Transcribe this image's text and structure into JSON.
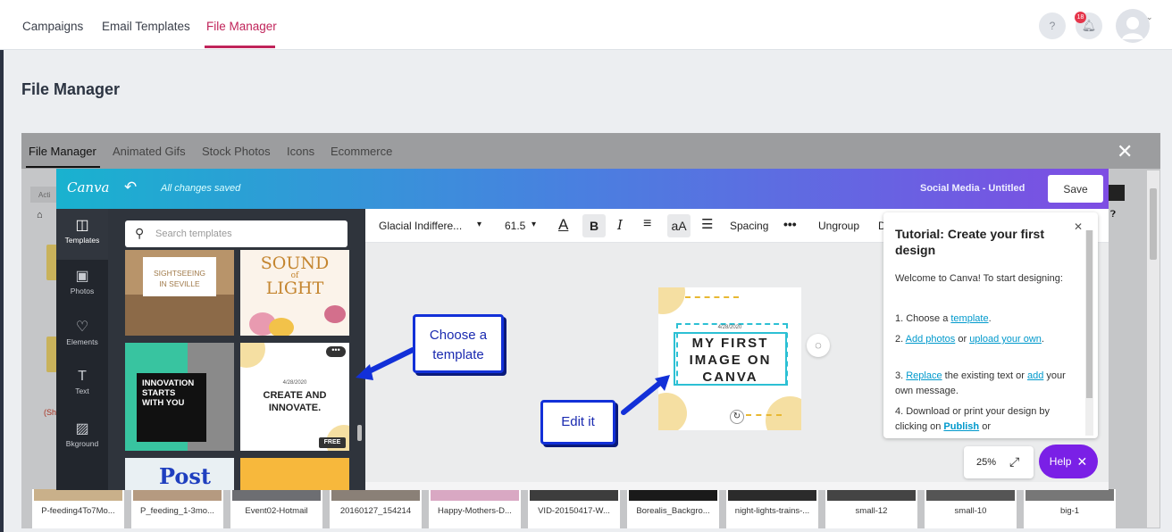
{
  "topnav": {
    "tabs": [
      "Campaigns",
      "Email Templates",
      "File Manager"
    ],
    "active": "File Manager",
    "help_glyph": "?",
    "notif_count": "18"
  },
  "page": {
    "title": "File Manager"
  },
  "modal": {
    "tabs": [
      "File Manager",
      "Animated Gifs",
      "Stock Photos",
      "Icons",
      "Ecommerce"
    ],
    "behind_label": "(Sh",
    "thumbnails": [
      "P-feeding4To7Mo...",
      "P_feeding_1-3mo...",
      "Event02-Hotmail",
      "20160127_154214",
      "Happy-Mothers-D...",
      "VID-20150417-W...",
      "Borealis_Backgro...",
      "night-lights-trains-...",
      "small-12",
      "small-10",
      "big-1"
    ]
  },
  "canva": {
    "logo": "Canva",
    "saved_status": "All changes saved",
    "doc_title": "Social Media - Untitled",
    "save_label": "Save",
    "rail": [
      {
        "label": "Templates",
        "icon": "templates-icon"
      },
      {
        "label": "Photos",
        "icon": "photos-icon"
      },
      {
        "label": "Elements",
        "icon": "elements-icon"
      },
      {
        "label": "Text",
        "icon": "text-icon"
      },
      {
        "label": "Bkground",
        "icon": "background-icon"
      }
    ],
    "search_placeholder": "Search templates",
    "templates": {
      "t1": {
        "line1": "SIGHTSEEING",
        "line2": "IN SEVILLE"
      },
      "t2": {
        "line1": "SOUND",
        "line2": "of",
        "line3": "LIGHT"
      },
      "t3": {
        "line1": "INNOVATION",
        "line2": "STARTS",
        "line3": "WITH YOU"
      },
      "t4": {
        "date": "4/28/2020",
        "line1": "CREATE AND",
        "line2": "INNOVATE.",
        "badge": "FREE"
      },
      "t5": {
        "text": "Post"
      }
    },
    "toolbar": {
      "font": "Glacial Indiffere...",
      "size": "61.5",
      "spacing": "Spacing",
      "ungroup": "Ungroup",
      "overflow_letter": "D"
    },
    "design": {
      "date": "4/28/2020",
      "line1": "MY FIRST",
      "line2": "IMAGE ON",
      "line3": "CANVA"
    },
    "tutorial": {
      "title": "Tutorial: Create your first design",
      "intro": "Welcome to Canva! To start designing:",
      "step1_pre": "1. Choose a ",
      "step1_link": "template",
      "step1_post": ".",
      "step2_pre": "2. ",
      "step2_link1": "Add photos",
      "step2_mid": " or ",
      "step2_link2": "upload your own",
      "step2_post": ".",
      "step3_pre": "3. ",
      "step3_link1": "Replace",
      "step3_mid": " the existing text or ",
      "step3_link2": "add",
      "step3_post": " your own message.",
      "step4_pre": "4. Download or print your design by clicking on ",
      "step4_link": "Publish",
      "step4_post": " or"
    },
    "zoom": "25%",
    "help_label": "Help"
  },
  "callouts": {
    "choose": "Choose a template",
    "edit": "Edit it"
  },
  "colors": {
    "accent": "#c0245a",
    "canva_purple": "#7a20e6",
    "callout_blue": "#1230d8"
  }
}
